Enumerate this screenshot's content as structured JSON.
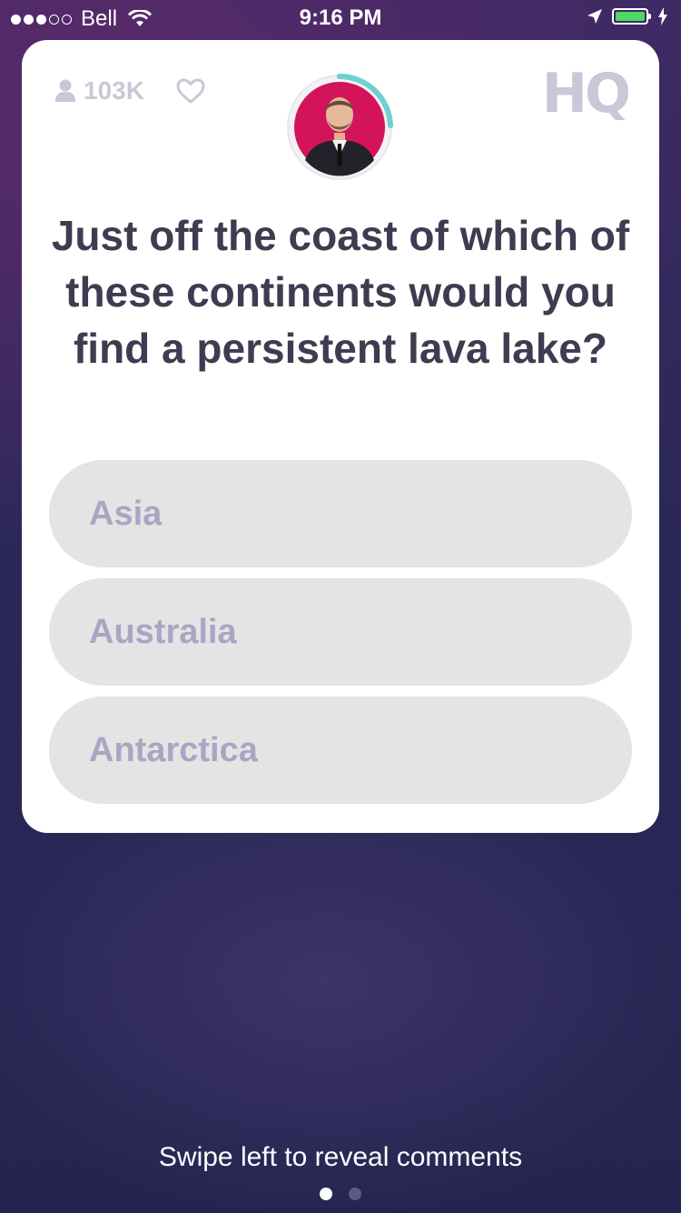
{
  "status_bar": {
    "carrier": "Bell",
    "time": "9:16 PM",
    "signal_bars_filled": 3,
    "signal_bars_total": 5,
    "battery_color": "#4cd964"
  },
  "header": {
    "viewers": "103K",
    "logo": "HQ",
    "timer_color": "#6fd0d0"
  },
  "question": {
    "text": "Just off the coast of which of these continents would you find a persistent lava lake?",
    "answers": [
      "Asia",
      "Australia",
      "Antarctica"
    ]
  },
  "footer": {
    "hint": "Swipe left to reveal comments",
    "page_index": 0,
    "page_count": 2
  }
}
